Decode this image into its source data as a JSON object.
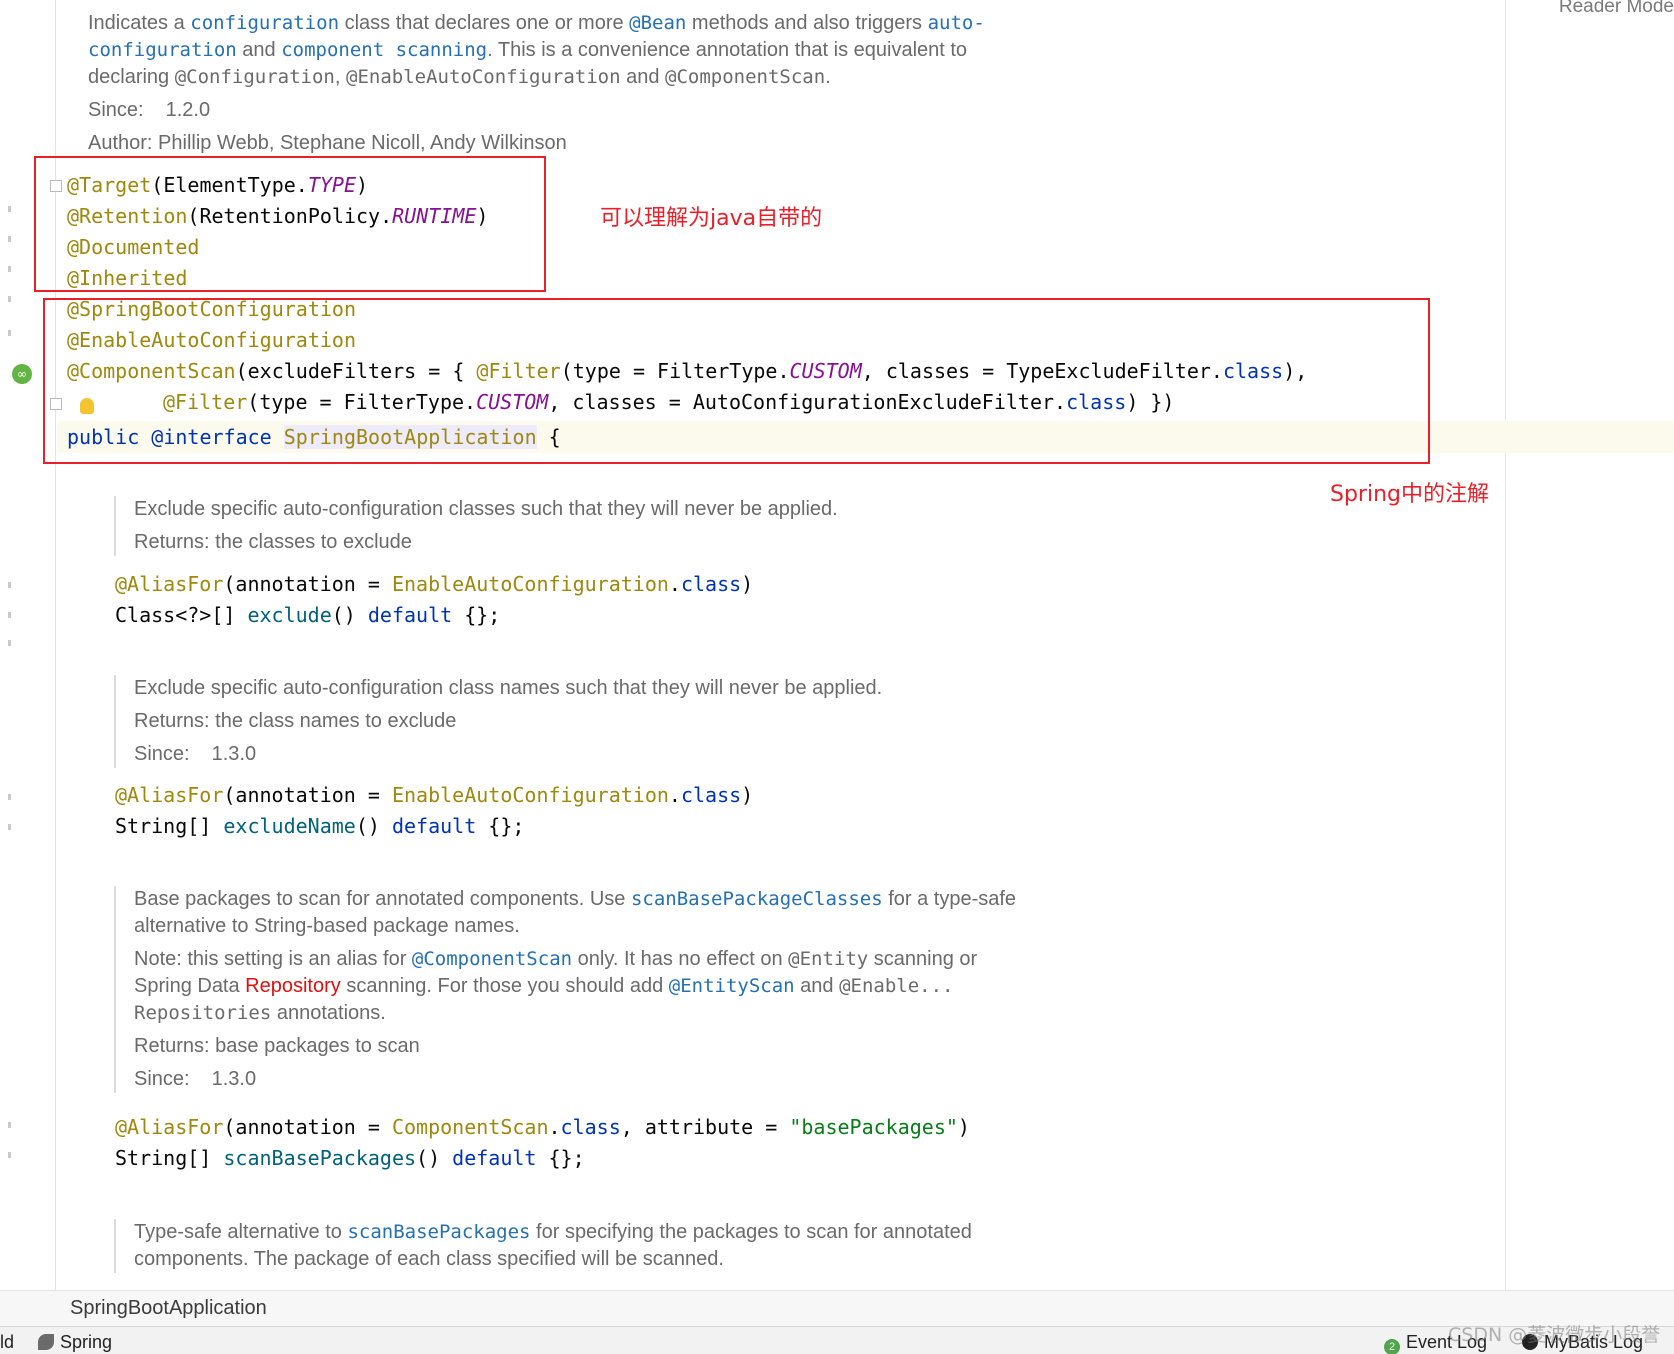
{
  "reader_mode": "Reader Mode",
  "top_doc": {
    "line1_pre": "Indicates a ",
    "line1_link1": "configuration",
    "line1_mid": " class that declares one or more ",
    "line1_link2": "@Bean",
    "line1_post": " methods and also triggers ",
    "line1_link3": "auto-",
    "line2_link1": "configuration",
    "line2_mid": " and ",
    "line2_link2": "component scanning",
    "line2_post": ". This is a convenience annotation that is equivalent to",
    "line3_pre": "declaring ",
    "line3_code1": "@Configuration",
    "line3_sep": ", ",
    "line3_code2": "@EnableAutoConfiguration",
    "line3_and": " and ",
    "line3_code3": "@ComponentScan",
    "line3_end": ".",
    "since_label": "Since:",
    "since_value": "1.2.0",
    "author": "Author: Phillip Webb, Stephane Nicoll, Andy Wilkinson"
  },
  "code": {
    "target_ann": "@Target",
    "target_arg_pre": "(ElementType.",
    "target_arg_const": "TYPE",
    "target_arg_post": ")",
    "retention_ann": "@Retention",
    "retention_arg_pre": "(RetentionPolicy.",
    "retention_arg_const": "RUNTIME",
    "retention_arg_post": ")",
    "documented": "@Documented",
    "inherited": "@Inherited",
    "sbc": "@SpringBootConfiguration",
    "eac": "@EnableAutoConfiguration",
    "cs_ann": "@ComponentScan",
    "cs_1": "(excludeFilters = { ",
    "cs_filter": "@Filter",
    "cs_2": "(type = FilterType.",
    "cs_custom": "CUSTOM",
    "cs_3": ", classes = TypeExcludeFilter.",
    "cs_class": "class",
    "cs_4": "),",
    "f2_filter": "@Filter",
    "f2_1": "(type = FilterType.",
    "f2_custom": "CUSTOM",
    "f2_2": ", classes = AutoConfigurationExcludeFilter.",
    "f2_class": "class",
    "f2_3": ") })",
    "decl_public": "public",
    "decl_interface": "@interface",
    "decl_name": "SpringBootApplication",
    "decl_brace": " {"
  },
  "notes": {
    "java_note": "可以理解为java自带的",
    "spring_note": "Spring中的注解"
  },
  "exclude": {
    "doc1": "Exclude specific auto-configuration classes such that they will never be applied.",
    "returns": "Returns: the classes to exclude",
    "alias_ann": "@AliasFor",
    "alias_pre": "(annotation = ",
    "alias_target": "EnableAutoConfiguration",
    "alias_dot": ".",
    "alias_class": "class",
    "alias_post": ")",
    "decl_type": "Class<?>[] ",
    "decl_meth": "exclude",
    "decl_paren": "() ",
    "decl_default": "default",
    "decl_end": " {};"
  },
  "exclude_name": {
    "doc1": "Exclude specific auto-configuration class names such that they will never be applied.",
    "returns": "Returns: the class names to exclude",
    "since_label": "Since:",
    "since_value": "1.3.0",
    "alias_ann": "@AliasFor",
    "alias_pre": "(annotation = ",
    "alias_target": "EnableAutoConfiguration",
    "alias_dot": ".",
    "alias_class": "class",
    "alias_post": ")",
    "decl_type": "String[] ",
    "decl_meth": "excludeName",
    "decl_paren": "() ",
    "decl_default": "default",
    "decl_end": " {};"
  },
  "scan": {
    "l1_pre": "Base packages to scan for annotated components. Use ",
    "l1_link": "scanBasePackageClasses",
    "l1_post": " for a type-safe",
    "l2": "alternative to String-based package names.",
    "l3_pre": "Note: this setting is an alias for ",
    "l3_link": "@ComponentScan",
    "l3_mid": " only. It has no effect on ",
    "l3_code": "@Entity",
    "l3_post": " scanning or",
    "l4_pre": "Spring Data ",
    "l4_red": "Repository",
    "l4_mid": " scanning. For those you should add ",
    "l4_link": "@EntityScan",
    "l4_and": " and ",
    "l4_code": "@Enable...",
    "l5_code": "Repositories",
    "l5_post": " annotations.",
    "returns": "Returns: base packages to scan",
    "since_label": "Since:",
    "since_value": "1.3.0",
    "alias_ann": "@AliasFor",
    "alias_pre": "(annotation = ",
    "alias_target": "ComponentScan",
    "alias_dot": ".",
    "alias_class": "class",
    "alias_mid": ", attribute = ",
    "alias_str": "\"basePackages\"",
    "alias_post": ")",
    "decl_type": "String[] ",
    "decl_meth": "scanBasePackages",
    "decl_paren": "() ",
    "decl_default": "default",
    "decl_end": " {};"
  },
  "type_safe": {
    "l1_pre": "Type-safe alternative to ",
    "l1_link": "scanBasePackages",
    "l1_post": " for specifying the packages to scan for annotated",
    "l2": "components. The package of each class specified will be scanned."
  },
  "breadcrumb": "SpringBootApplication",
  "status": {
    "left_fragment": "ld",
    "spring_tab": "Spring",
    "event_count": "2",
    "event_log": "Event Log",
    "mybatis_log": "MyBatis Log"
  },
  "watermark": "CSDN @菱波微步小段誉"
}
